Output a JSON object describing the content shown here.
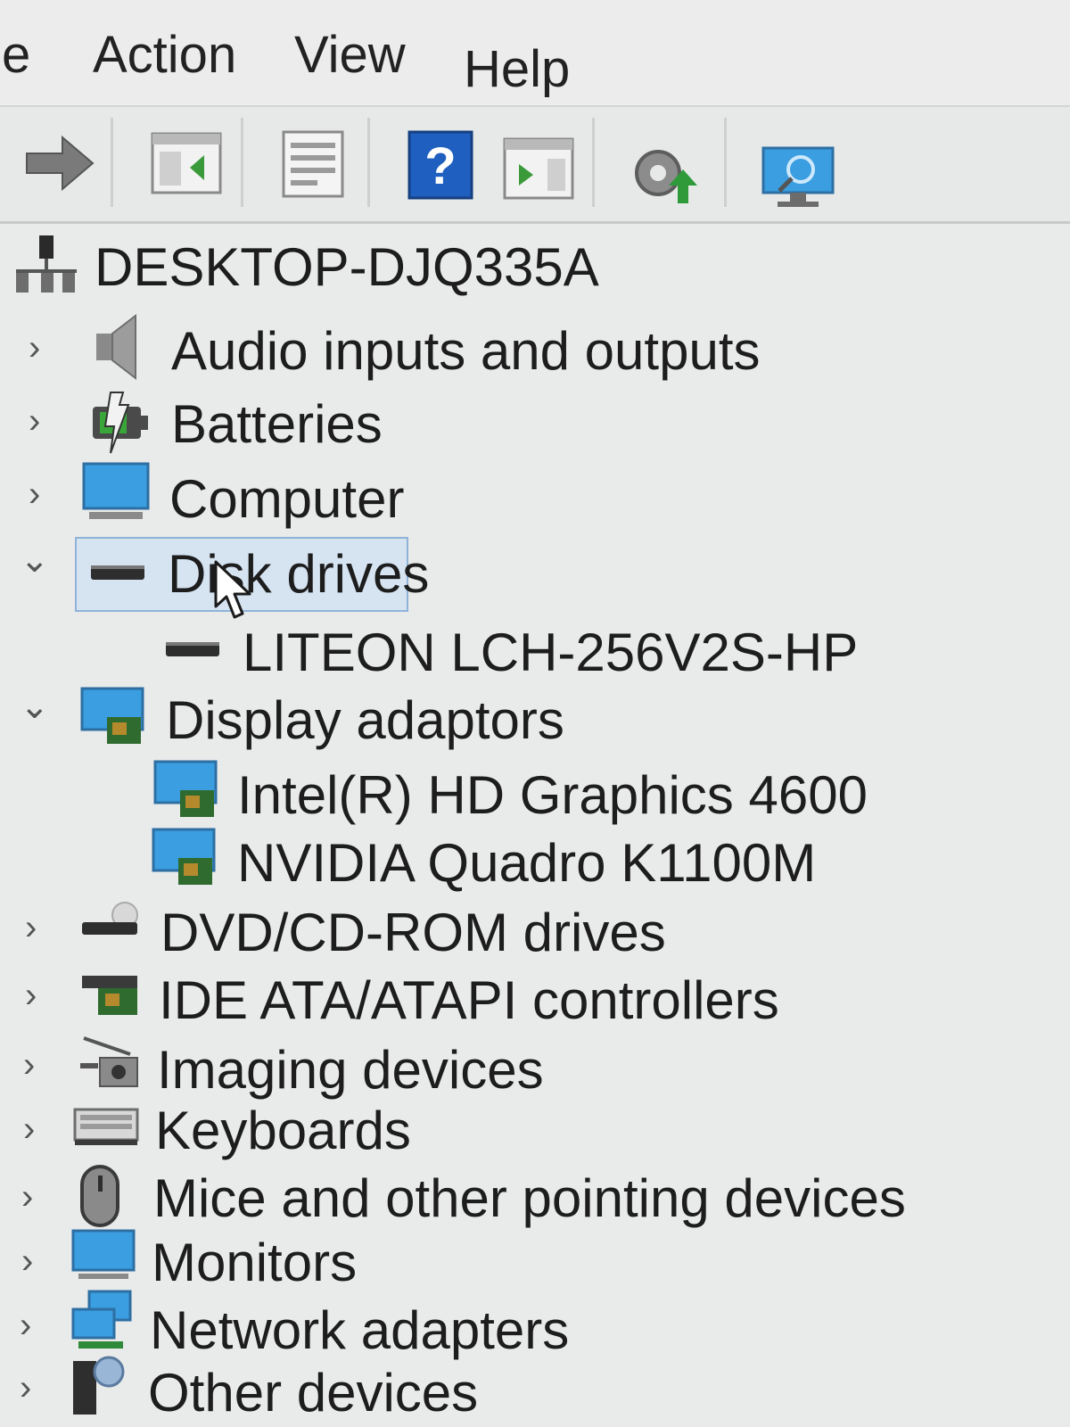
{
  "menu": {
    "file_fragment": "e",
    "action": "Action",
    "view": "View",
    "help": "Help"
  },
  "toolbar": {
    "buttons": [
      {
        "icon": "forward-arrow-icon"
      },
      {
        "icon": "show-hide-console-tree-icon"
      },
      {
        "icon": "properties-icon"
      },
      {
        "icon": "help-icon",
        "glyph": "?"
      },
      {
        "icon": "show-action-pane-icon"
      },
      {
        "icon": "update-driver-icon"
      },
      {
        "icon": "scan-hardware-changes-icon"
      }
    ]
  },
  "tree": {
    "root": "DESKTOP-DJQ335A",
    "categories": {
      "audio": "Audio inputs and outputs",
      "batteries": "Batteries",
      "computer": "Computer",
      "disk_drives": "Disk drives",
      "disk_child": "LITEON LCH-256V2S-HP",
      "display_adaptors": "Display adaptors",
      "display_child_1": "Intel(R) HD Graphics 4600",
      "display_child_2": "NVIDIA Quadro K1100M",
      "dvd": "DVD/CD-ROM drives",
      "ide": "IDE ATA/ATAPI controllers",
      "imaging": "Imaging devices",
      "keyboards": "Keyboards",
      "mice": "Mice and other pointing devices",
      "monitors": "Monitors",
      "network": "Network adapters",
      "other": "Other devices"
    },
    "expander_collapsed": "›",
    "expander_expanded": "⌄"
  },
  "colors": {
    "selection_fill": "#d6e4f2",
    "selection_border": "#8fb3d8",
    "help_blue": "#1f5fbf",
    "monitor_blue": "#3a9ee0"
  }
}
